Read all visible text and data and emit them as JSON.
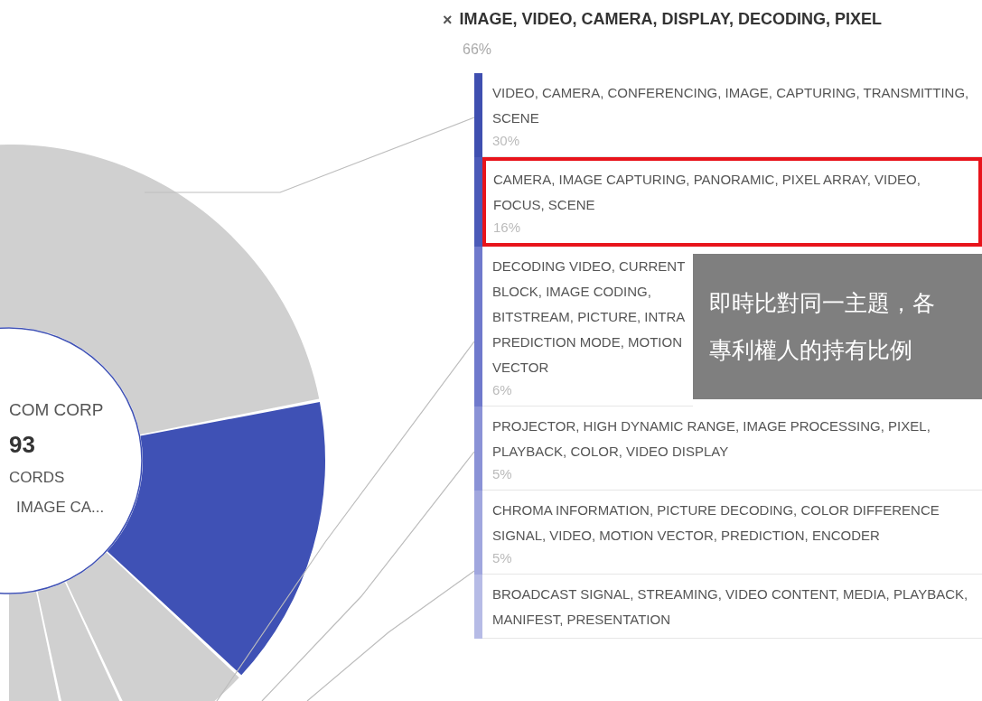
{
  "center_label": {
    "title": "COM CORP",
    "count": "93",
    "unit": "CORDS",
    "topic": "IMAGE CA..."
  },
  "topic_panel": {
    "close_icon": "×",
    "title": "IMAGE, VIDEO, CAMERA, DISPLAY, DECODING, PIXEL",
    "share": "66%",
    "subtopics": [
      {
        "label": "VIDEO, CAMERA, CONFERENCING, IMAGE, CAPTURING, TRANSMITTING, SCENE",
        "share": "30%",
        "color": "#3f4fb0",
        "highlighted": false
      },
      {
        "label": "CAMERA, IMAGE CAPTURING, PANORAMIC, PIXEL ARRAY, VIDEO, FOCUS, SCENE",
        "share": "16%",
        "color": "#4b5ab8",
        "highlighted": true
      },
      {
        "label": "DECODING VIDEO, CURRENT BLOCK, IMAGE CODING, BITSTREAM, PICTURE, INTRA PREDICTION MODE, MOTION VECTOR",
        "share": "6%",
        "color": "#6f79cc",
        "highlighted": false
      },
      {
        "label": "PROJECTOR, HIGH DYNAMIC RANGE, IMAGE PROCESSING, PIXEL, PLAYBACK, COLOR, VIDEO DISPLAY",
        "share": "5%",
        "color": "#8a92d6",
        "highlighted": false
      },
      {
        "label": "CHROMA INFORMATION, PICTURE DECODING, COLOR DIFFERENCE SIGNAL, VIDEO, MOTION VECTOR, PREDICTION, ENCODER",
        "share": "5%",
        "color": "#a0a6de",
        "highlighted": false
      },
      {
        "label": "BROADCAST SIGNAL, STREAMING, VIDEO CONTENT, MEDIA, PLAYBACK, MANIFEST, PRESENTATION",
        "color": "#b6bbe6",
        "highlighted": false
      }
    ]
  },
  "caption": {
    "lines": [
      "即時比對同一主題，各",
      "專利權人的持有比例"
    ]
  }
}
